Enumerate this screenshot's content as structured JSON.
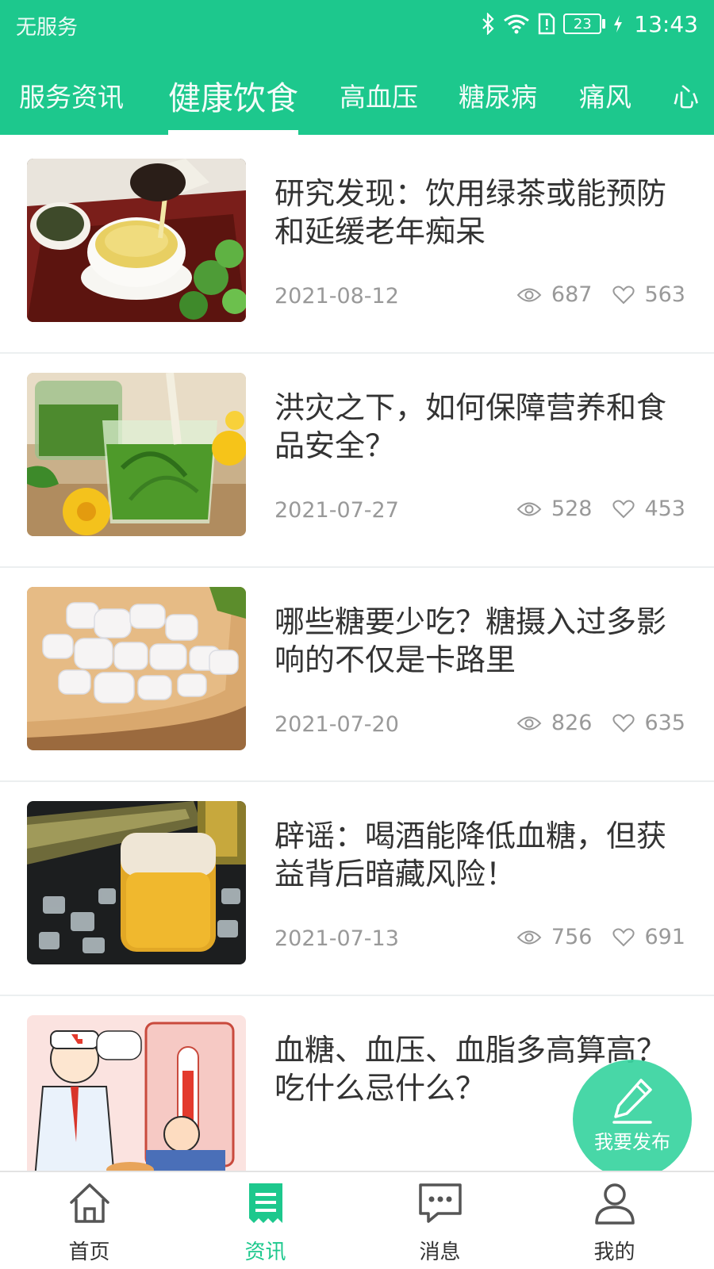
{
  "status_bar": {
    "carrier": "无服务",
    "battery": "23",
    "time": "13:43"
  },
  "tabs": [
    {
      "label": "服务资讯",
      "active": false
    },
    {
      "label": "健康饮食",
      "active": true
    },
    {
      "label": "高血压",
      "active": false
    },
    {
      "label": "糖尿病",
      "active": false
    },
    {
      "label": "痛风",
      "active": false
    },
    {
      "label": "心",
      "active": false
    }
  ],
  "articles": [
    {
      "title": "研究发现：饮用绿茶或能预防和延缓老年痴呆",
      "date": "2021-08-12",
      "views": "687",
      "likes": "563",
      "thumb": "green-tea"
    },
    {
      "title": "洪灾之下，如何保障营养和食品安全？",
      "date": "2021-07-27",
      "views": "528",
      "likes": "453",
      "thumb": "dandelion-tea"
    },
    {
      "title": "哪些糖要少吃？糖摄入过多影响的不仅是卡路里",
      "date": "2021-07-20",
      "views": "826",
      "likes": "635",
      "thumb": "rock-sugar"
    },
    {
      "title": "辟谣：喝酒能降低血糖，但获益背后暗藏风险！",
      "date": "2021-07-13",
      "views": "756",
      "likes": "691",
      "thumb": "beer"
    },
    {
      "title": "血糖、血压、血脂多高算高？吃什么忌什么？",
      "date": "",
      "views": "",
      "likes": "",
      "thumb": "cartoon-doctor"
    }
  ],
  "fab": {
    "label": "我要发布",
    "icon": "pen-icon"
  },
  "bottom_nav": [
    {
      "label": "首页",
      "icon": "home-icon",
      "active": false
    },
    {
      "label": "资讯",
      "icon": "news-icon",
      "active": true
    },
    {
      "label": "消息",
      "icon": "message-icon",
      "active": false
    },
    {
      "label": "我的",
      "icon": "user-icon",
      "active": false
    }
  ],
  "colors": {
    "brand": "#1dc88d",
    "fab": "#38d4a0",
    "meta_text": "#999999",
    "title_text": "#333333"
  }
}
